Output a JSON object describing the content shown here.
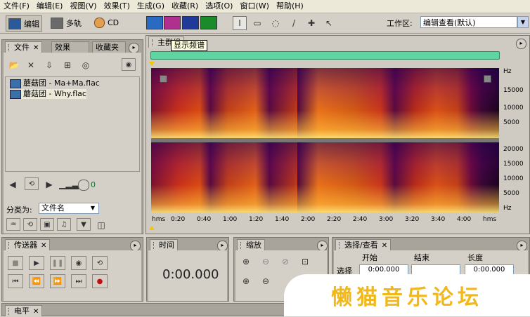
{
  "menubar": {
    "items": [
      "文件(F)",
      "编辑(E)",
      "视图(V)",
      "效果(T)",
      "生成(G)",
      "收藏(R)",
      "选项(O)",
      "窗口(W)",
      "帮助(H)"
    ]
  },
  "toolbar": {
    "edit_label": "编辑",
    "multitrack_label": "多轨",
    "cd_label": "CD",
    "workspace_label": "工作区:",
    "workspace_value": "编辑查看(默认)"
  },
  "files_panel": {
    "tabs": [
      "文件",
      "效果",
      "收藏夹"
    ],
    "files": [
      "蘑菇团 - Ma+Ma.flac",
      "蘑菇团 - Why.flac"
    ],
    "volume_value": "0",
    "sort_label": "分类为:",
    "sort_value": "文件名"
  },
  "main": {
    "tab": "主群组",
    "tooltip": "显示频谱",
    "y_unit": "Hz",
    "y_labels_top": [
      "15000",
      "10000",
      "5000"
    ],
    "y_labels_bottom": [
      "20000",
      "15000",
      "10000",
      "5000"
    ],
    "time_unit": "hms",
    "time_labels": [
      "0:20",
      "0:40",
      "1:00",
      "1:20",
      "1:40",
      "2:00",
      "2:20",
      "2:40",
      "3:00",
      "3:20",
      "3:40",
      "4:00"
    ]
  },
  "transport": {
    "tab": "传送器"
  },
  "time_panel": {
    "tab": "时间",
    "value": "0:00.000"
  },
  "zoom_panel": {
    "tab": "缩放"
  },
  "selection_panel": {
    "tab": "选择/查看",
    "col_start": "开始",
    "col_end": "结束",
    "col_length": "长度",
    "row_label": "选择",
    "start_value": "0:00.000",
    "end_value": "",
    "length_value": "0:00.000"
  },
  "level_panel": {
    "tab": "电平"
  },
  "watermark": {
    "text": "懒猫音乐论坛"
  },
  "colors": {
    "accent_green": "#5fd6a2",
    "playhead": "#f2c800",
    "watermark": "#f0b81a"
  }
}
